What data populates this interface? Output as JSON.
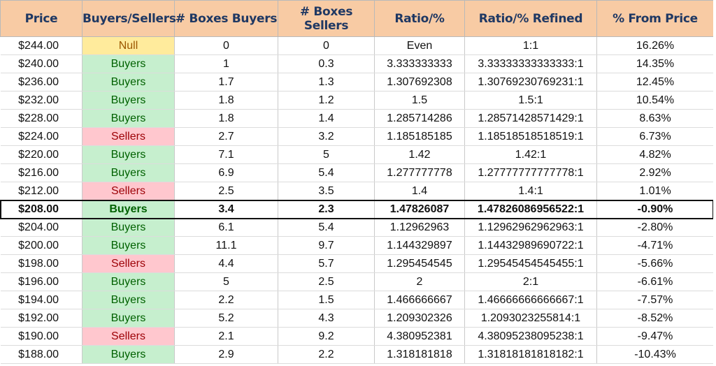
{
  "columns": [
    "Price",
    "Buyers/Sellers",
    "# Boxes Buyers",
    "# Boxes Sellers",
    "Ratio/%",
    "Ratio/% Refined",
    "% From Price"
  ],
  "rows": [
    {
      "price": "$244.00",
      "side": "Null",
      "side_type": "null",
      "boxes_buyers": "0",
      "boxes_sellers": "0",
      "ratio": "Even",
      "ratio_refined": "1:1",
      "pct": "16.26%"
    },
    {
      "price": "$240.00",
      "side": "Buyers",
      "side_type": "buyers",
      "boxes_buyers": "1",
      "boxes_sellers": "0.3",
      "ratio": "3.333333333",
      "ratio_refined": "3.33333333333333:1",
      "pct": "14.35%"
    },
    {
      "price": "$236.00",
      "side": "Buyers",
      "side_type": "buyers",
      "boxes_buyers": "1.7",
      "boxes_sellers": "1.3",
      "ratio": "1.307692308",
      "ratio_refined": "1.30769230769231:1",
      "pct": "12.45%"
    },
    {
      "price": "$232.00",
      "side": "Buyers",
      "side_type": "buyers",
      "boxes_buyers": "1.8",
      "boxes_sellers": "1.2",
      "ratio": "1.5",
      "ratio_refined": "1.5:1",
      "pct": "10.54%"
    },
    {
      "price": "$228.00",
      "side": "Buyers",
      "side_type": "buyers",
      "boxes_buyers": "1.8",
      "boxes_sellers": "1.4",
      "ratio": "1.285714286",
      "ratio_refined": "1.28571428571429:1",
      "pct": "8.63%"
    },
    {
      "price": "$224.00",
      "side": "Sellers",
      "side_type": "sellers",
      "boxes_buyers": "2.7",
      "boxes_sellers": "3.2",
      "ratio": "1.185185185",
      "ratio_refined": "1.18518518518519:1",
      "pct": "6.73%"
    },
    {
      "price": "$220.00",
      "side": "Buyers",
      "side_type": "buyers",
      "boxes_buyers": "7.1",
      "boxes_sellers": "5",
      "ratio": "1.42",
      "ratio_refined": "1.42:1",
      "pct": "4.82%"
    },
    {
      "price": "$216.00",
      "side": "Buyers",
      "side_type": "buyers",
      "boxes_buyers": "6.9",
      "boxes_sellers": "5.4",
      "ratio": "1.277777778",
      "ratio_refined": "1.27777777777778:1",
      "pct": "2.92%"
    },
    {
      "price": "$212.00",
      "side": "Sellers",
      "side_type": "sellers",
      "boxes_buyers": "2.5",
      "boxes_sellers": "3.5",
      "ratio": "1.4",
      "ratio_refined": "1.4:1",
      "pct": "1.01%"
    },
    {
      "price": "$208.00",
      "side": "Buyers",
      "side_type": "buyers",
      "boxes_buyers": "3.4",
      "boxes_sellers": "2.3",
      "ratio": "1.47826087",
      "ratio_refined": "1.47826086956522:1",
      "pct": "-0.90%",
      "highlight": true
    },
    {
      "price": "$204.00",
      "side": "Buyers",
      "side_type": "buyers",
      "boxes_buyers": "6.1",
      "boxes_sellers": "5.4",
      "ratio": "1.12962963",
      "ratio_refined": "1.12962962962963:1",
      "pct": "-2.80%"
    },
    {
      "price": "$200.00",
      "side": "Buyers",
      "side_type": "buyers",
      "boxes_buyers": "11.1",
      "boxes_sellers": "9.7",
      "ratio": "1.144329897",
      "ratio_refined": "1.14432989690722:1",
      "pct": "-4.71%"
    },
    {
      "price": "$198.00",
      "side": "Sellers",
      "side_type": "sellers",
      "boxes_buyers": "4.4",
      "boxes_sellers": "5.7",
      "ratio": "1.295454545",
      "ratio_refined": "1.29545454545455:1",
      "pct": "-5.66%"
    },
    {
      "price": "$196.00",
      "side": "Buyers",
      "side_type": "buyers",
      "boxes_buyers": "5",
      "boxes_sellers": "2.5",
      "ratio": "2",
      "ratio_refined": "2:1",
      "pct": "-6.61%"
    },
    {
      "price": "$194.00",
      "side": "Buyers",
      "side_type": "buyers",
      "boxes_buyers": "2.2",
      "boxes_sellers": "1.5",
      "ratio": "1.466666667",
      "ratio_refined": "1.46666666666667:1",
      "pct": "-7.57%"
    },
    {
      "price": "$192.00",
      "side": "Buyers",
      "side_type": "buyers",
      "boxes_buyers": "5.2",
      "boxes_sellers": "4.3",
      "ratio": "1.209302326",
      "ratio_refined": "1.2093023255814:1",
      "pct": "-8.52%"
    },
    {
      "price": "$190.00",
      "side": "Sellers",
      "side_type": "sellers",
      "boxes_buyers": "2.1",
      "boxes_sellers": "9.2",
      "ratio": "4.380952381",
      "ratio_refined": "4.38095238095238:1",
      "pct": "-9.47%"
    },
    {
      "price": "$188.00",
      "side": "Buyers",
      "side_type": "buyers",
      "boxes_buyers": "2.9",
      "boxes_sellers": "2.2",
      "ratio": "1.318181818",
      "ratio_refined": "1.31818181818182:1",
      "pct": "-10.43%"
    }
  ]
}
